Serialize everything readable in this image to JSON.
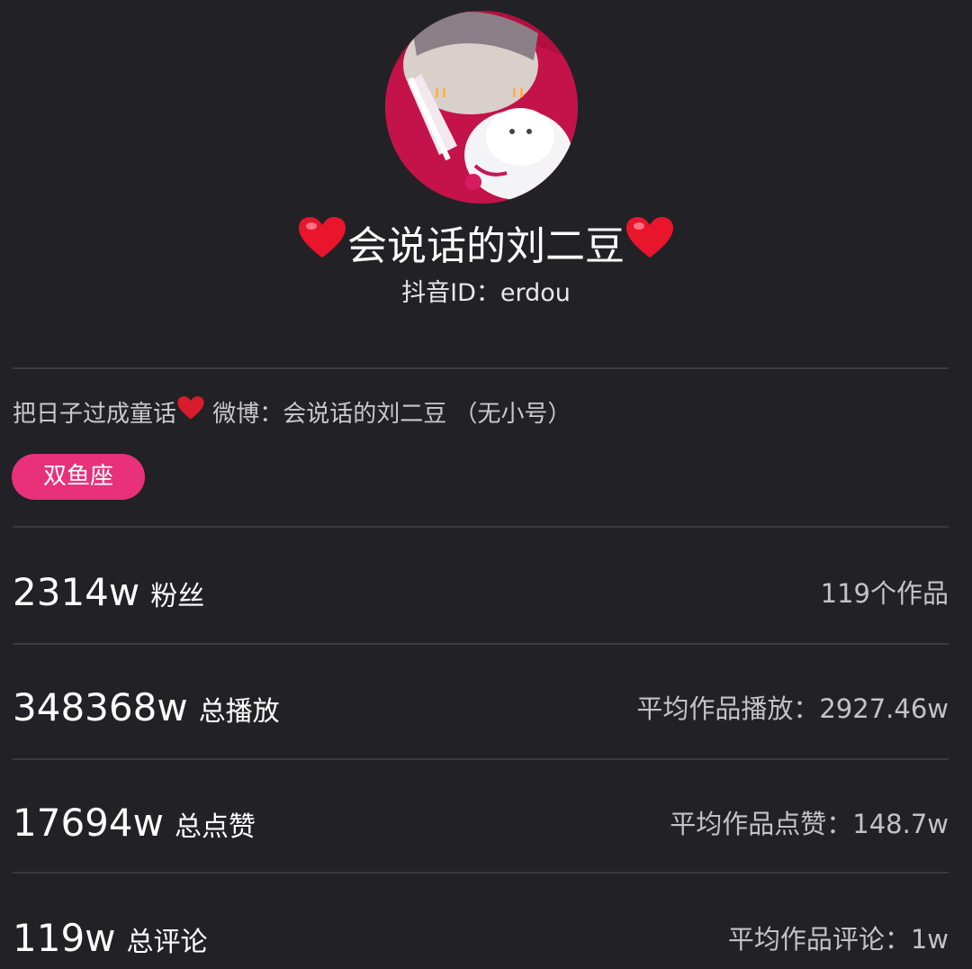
{
  "profile": {
    "avatar_icon": "avatar-photo-person-with-white-cat",
    "heart_icon": "red-heart-emoji",
    "nickname": "会说话的刘二豆",
    "id_label": "抖音ID：",
    "id_value": "erdou",
    "bio_part1": "把日子过成童话",
    "bio_part2": " 微博：会说话的刘二豆 （无小号）",
    "tag": "双鱼座",
    "colors": {
      "background": "#222226",
      "tag": "#e8317a",
      "heart": "#e8152d"
    }
  },
  "stats": [
    {
      "value": "2314w",
      "label": "粉丝",
      "right": "119个作品"
    },
    {
      "value": "348368w",
      "label": "总播放",
      "right": "平均作品播放：2927.46w"
    },
    {
      "value": "17694w",
      "label": "总点赞",
      "right": "平均作品点赞：148.7w"
    },
    {
      "value": "119w",
      "label": "总评论",
      "right": "平均作品评论：1w"
    }
  ]
}
